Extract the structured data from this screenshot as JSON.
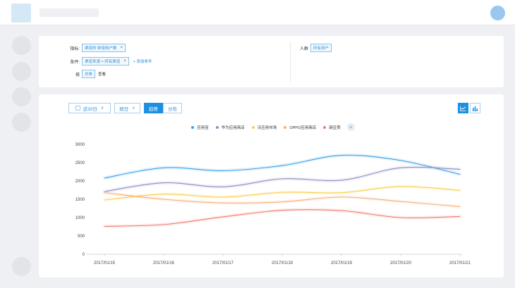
{
  "filters": {
    "metric_label": "指标:",
    "metric_tag": "渠道的 新增用户数",
    "condition_label": "条件:",
    "condition_tag": "渠道来源 = 所有渠道",
    "add_condition": "+ 添加条件",
    "group_label": "按",
    "group_tag": "总体",
    "group_suffix": "查看",
    "audience_label": "人群",
    "audience_tag": "所有用户",
    "remove_glyph": "×"
  },
  "toolbar": {
    "date_range": "近30日",
    "granularity": "按日",
    "tab_trend": "趋势",
    "tab_distribution": "分布",
    "chevron_glyph": "∨",
    "line_icon": "line-chart-icon",
    "bar_icon": "bar-chart-icon"
  },
  "legend": {
    "add_glyph": "+"
  },
  "colors": {
    "accent": "#1b8fe0",
    "series_1": "#3aa0e8",
    "series_2": "#8f8cc8",
    "series_3": "#f6cf4c",
    "series_4": "#f6ae78",
    "series_5": "#ee7c6d"
  },
  "chart_data": {
    "type": "line",
    "x": [
      "2017/01/15",
      "2017/01/16",
      "2017/01/17",
      "2017/01/18",
      "2017/01/19",
      "2017/01/20",
      "2017/01/21"
    ],
    "ylim": [
      0,
      3000
    ],
    "yticks": [
      0,
      500,
      1000,
      1500,
      2000,
      2500,
      3000
    ],
    "grid": false,
    "legend_position": "top-center",
    "series": [
      {
        "name": "应用宝",
        "color": "#3aa0e8",
        "values": [
          2080,
          2360,
          2280,
          2420,
          2700,
          2560,
          2180
        ]
      },
      {
        "name": "华为应用商店",
        "color": "#8f8cc8",
        "values": [
          1710,
          1950,
          1840,
          2060,
          2020,
          2360,
          2320
        ]
      },
      {
        "name": "沃应用市场",
        "color": "#f6cf4c",
        "values": [
          1480,
          1640,
          1560,
          1690,
          1680,
          1850,
          1740
        ]
      },
      {
        "name": "OPPO应用商店",
        "color": "#f6ae78",
        "values": [
          1680,
          1500,
          1400,
          1430,
          1560,
          1440,
          1300
        ]
      },
      {
        "name": "豌豆荚",
        "color": "#ee7c6d",
        "values": [
          760,
          810,
          1020,
          1200,
          1190,
          1000,
          1030
        ]
      }
    ]
  }
}
